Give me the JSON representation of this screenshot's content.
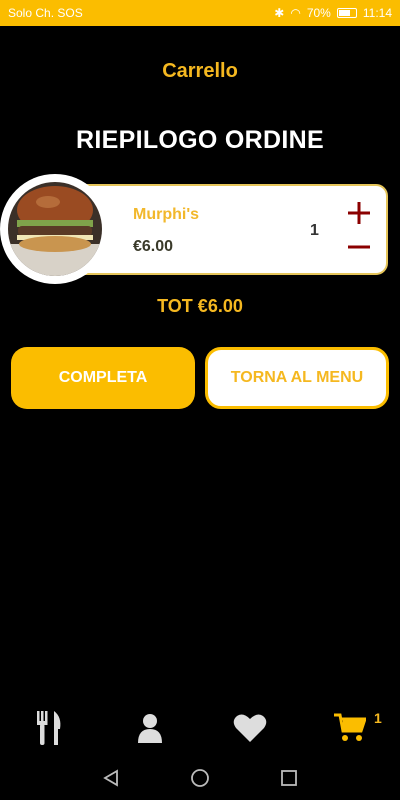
{
  "status_bar": {
    "left_text": "Solo Ch. SOS",
    "battery": "70%",
    "time": "11:14"
  },
  "header": {
    "title": "Carrello"
  },
  "summary": {
    "heading": "RIEPILOGO ORDINE"
  },
  "cart_items": [
    {
      "name": "Murphi's",
      "price": "€6.00",
      "quantity": "1",
      "image": "burger-photo"
    }
  ],
  "total": "TOT €6.00",
  "actions": {
    "complete_label": "COMPLETA",
    "back_label": "TORNA AL MENU"
  },
  "bottom_nav": {
    "items": [
      {
        "icon": "fork-knife-icon"
      },
      {
        "icon": "user-icon"
      },
      {
        "icon": "heart-icon"
      },
      {
        "icon": "cart-icon",
        "badge": "1"
      }
    ]
  },
  "colors": {
    "accent": "#FBBD00",
    "qty_controls": "#8B0000",
    "background": "#000000"
  }
}
